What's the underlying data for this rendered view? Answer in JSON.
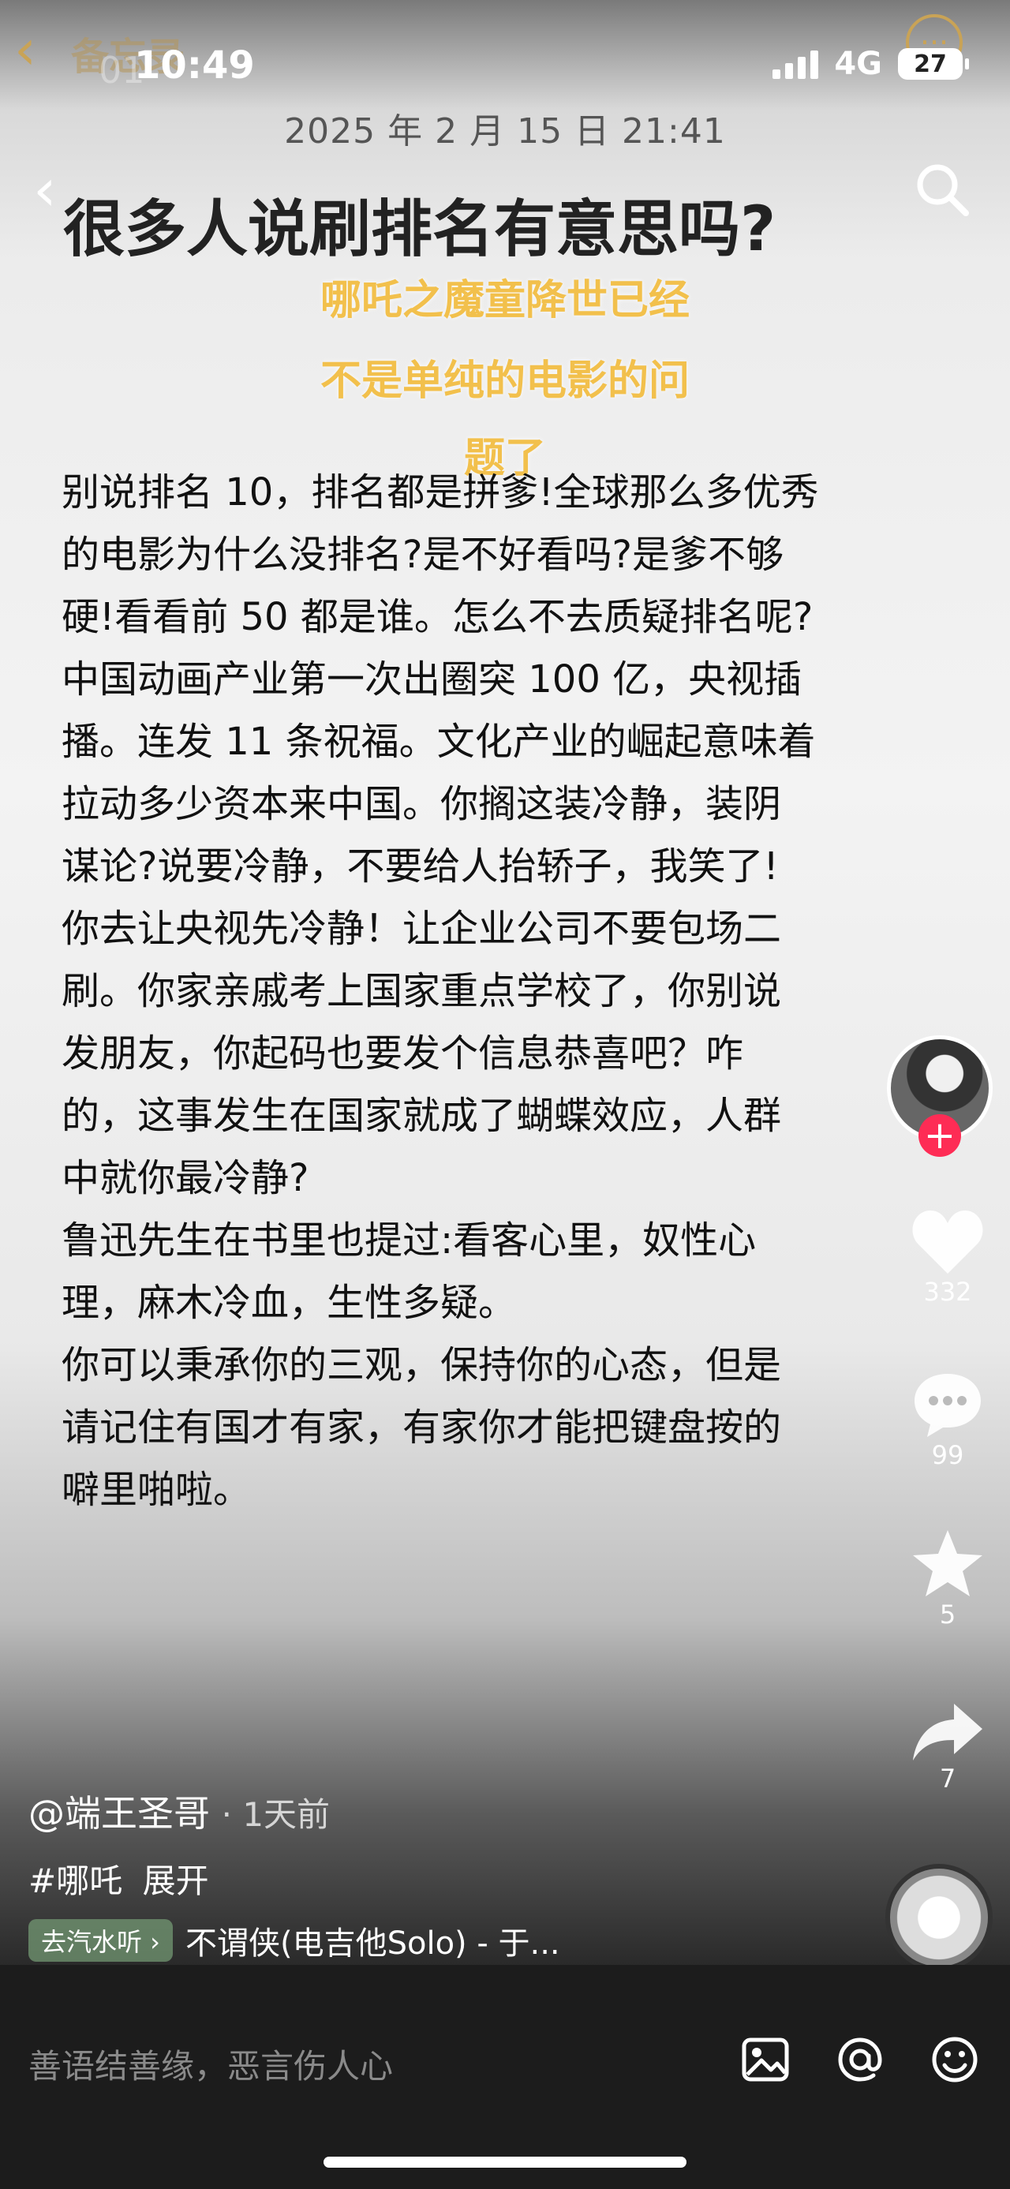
{
  "status_bar": {
    "time": "10:49",
    "network": "4G",
    "battery": "27"
  },
  "top_ghost": {
    "title": "备忘录",
    "number": "01"
  },
  "date": "2025 年 2 月 15 日 21:41",
  "headline": "很多人说刷排名有意思吗?",
  "overlay_caption": [
    "哪吒之魔童降世已经",
    "不是单纯的电影的问",
    "题了"
  ],
  "body_text": "别说排名 10，排名都是拼爹!全球那么多优秀\n的电影为什么没排名?是不好看吗?是爹不够\n硬!看看前 50 都是谁。怎么不去质疑排名呢?\n中国动画产业第一次出圈突 100 亿，央视插\n播。连发 11 条祝福。文化产业的崛起意味着\n拉动多少资本来中国。你搁这装冷静，装阴\n谋论?说要冷静，不要给人抬轿子，我笑了!\n你去让央视先冷静！让企业公司不要包场二\n刷。你家亲戚考上国家重点学校了，你别说\n发朋友，你起码也要发个信息恭喜吧？咋\n的，这事发生在国家就成了蝴蝶效应，人群\n中就你最冷静?\n鲁迅先生在书里也提过:看客心里，奴性心\n理，麻木冷血，生性多疑。\n你可以秉承你的三观，保持你的心态，但是\n请记住有国才有家，有家你才能把键盘按的\n噼里啪啦。",
  "side_actions": {
    "likes": "332",
    "comments": "99",
    "favorites": "5",
    "shares": "7"
  },
  "author": {
    "name": "@端王圣哥",
    "ago": "· 1天前"
  },
  "tags": {
    "tag": "#哪吒",
    "expand": "展开"
  },
  "music": {
    "chip": "去汽水听 ›",
    "title": "不谓侠(电吉他Solo) - 于..."
  },
  "comment_bar": {
    "placeholder": "善语结善缘，恶言伤人心"
  },
  "colors": {
    "accent_gold": "#c9a356",
    "overlay_yellow": "#f2c04c",
    "follow_red": "#fe2c55"
  }
}
